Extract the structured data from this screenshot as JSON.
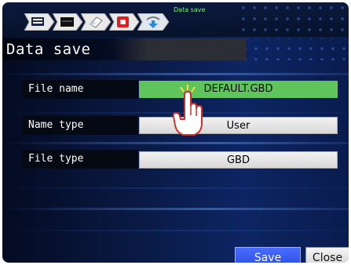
{
  "breadcrumb": {
    "active_label": "Data save",
    "steps": [
      "monitor-icon",
      "panel-icon",
      "eraser-icon",
      "record-icon",
      "download-icon"
    ]
  },
  "header": {
    "title": "Data save"
  },
  "fields": [
    {
      "label": "File name",
      "value": "DEFAULT.GBD",
      "state": "selected"
    },
    {
      "label": "Name type",
      "value": "User",
      "state": "normal"
    },
    {
      "label": "File type",
      "value": "GBD",
      "state": "normal"
    }
  ],
  "buttons": {
    "save": "Save",
    "close": "Close"
  },
  "colors": {
    "selected": "#5fc45c",
    "accent": "#2d4fe0",
    "crumb_label": "#7cf07c"
  }
}
